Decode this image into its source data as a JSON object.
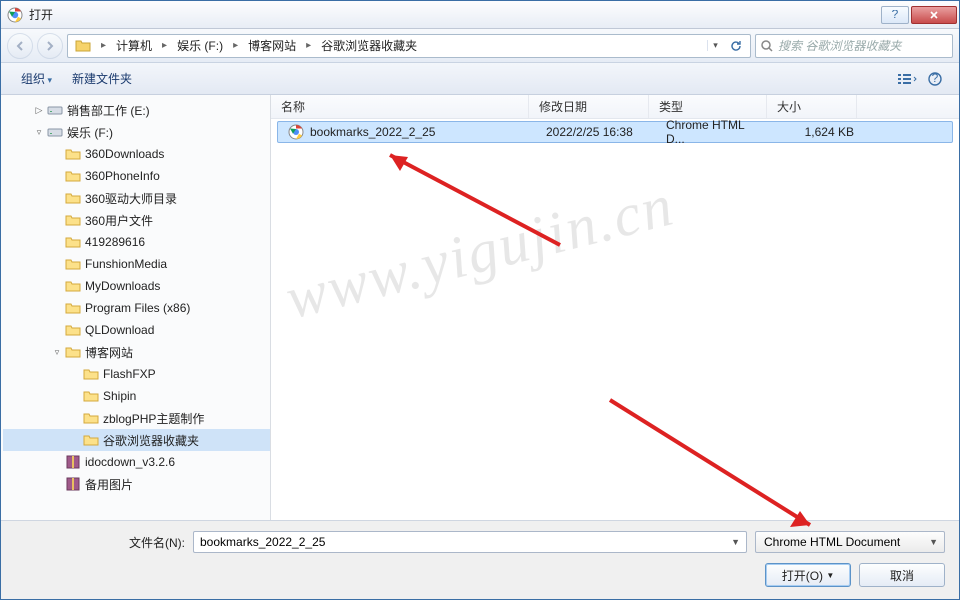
{
  "title": "打开",
  "breadcrumb": [
    "计算机",
    "娱乐 (F:)",
    "博客网站",
    "谷歌浏览器收藏夹"
  ],
  "search_placeholder": "搜索 谷歌浏览器收藏夹",
  "toolbar": {
    "organize": "组织",
    "newfolder": "新建文件夹"
  },
  "columns": {
    "name": "名称",
    "date": "修改日期",
    "type": "类型",
    "size": "大小"
  },
  "tree": [
    {
      "label": "销售部工作 (E:)",
      "icon": "drive",
      "indent": 1,
      "exp": "▷"
    },
    {
      "label": "娱乐 (F:)",
      "icon": "drive",
      "indent": 1,
      "exp": "▿"
    },
    {
      "label": "360Downloads",
      "icon": "folder",
      "indent": 2
    },
    {
      "label": "360PhoneInfo",
      "icon": "folder",
      "indent": 2
    },
    {
      "label": "360驱动大师目录",
      "icon": "folder",
      "indent": 2
    },
    {
      "label": "360用户文件",
      "icon": "folder",
      "indent": 2
    },
    {
      "label": "419289616",
      "icon": "folder",
      "indent": 2
    },
    {
      "label": "FunshionMedia",
      "icon": "folder",
      "indent": 2
    },
    {
      "label": "MyDownloads",
      "icon": "folder",
      "indent": 2
    },
    {
      "label": "Program Files (x86)",
      "icon": "folder",
      "indent": 2
    },
    {
      "label": "QLDownload",
      "icon": "folder",
      "indent": 2
    },
    {
      "label": "博客网站",
      "icon": "folder",
      "indent": 2,
      "exp": "▿"
    },
    {
      "label": "FlashFXP",
      "icon": "folder",
      "indent": 3
    },
    {
      "label": "Shipin",
      "icon": "folder",
      "indent": 3
    },
    {
      "label": "zblogPHP主题制作",
      "icon": "folder",
      "indent": 3
    },
    {
      "label": "谷歌浏览器收藏夹",
      "icon": "folder",
      "indent": 3,
      "selected": true
    },
    {
      "label": "idocdown_v3.2.6",
      "icon": "archive",
      "indent": 2
    },
    {
      "label": "备用图片",
      "icon": "archive",
      "indent": 2
    }
  ],
  "files": [
    {
      "name": "bookmarks_2022_2_25",
      "date": "2022/2/25 16:38",
      "type": "Chrome HTML D...",
      "size": "1,624 KB",
      "selected": true
    }
  ],
  "filename_label": "文件名(N):",
  "filename_value": "bookmarks_2022_2_25",
  "filter_value": "Chrome HTML Document",
  "buttons": {
    "open": "打开(O)",
    "cancel": "取消"
  },
  "watermark": "www.yigujin.cn"
}
